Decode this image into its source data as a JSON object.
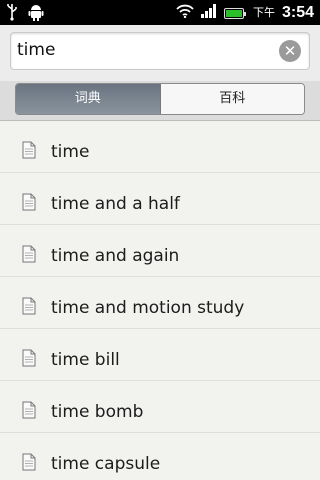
{
  "status_bar": {
    "ampm": "下午",
    "time": "3:54",
    "icons": [
      "usb-icon",
      "android-icon",
      "wifi-icon",
      "signal-icon",
      "battery-icon"
    ],
    "battery_color": "#2bc02b"
  },
  "search": {
    "value": "time"
  },
  "tabs": [
    {
      "label": "词典",
      "active": true
    },
    {
      "label": "百科",
      "active": false
    }
  ],
  "results": [
    {
      "label": "time"
    },
    {
      "label": "time and a half"
    },
    {
      "label": "time and again"
    },
    {
      "label": "time and motion study"
    },
    {
      "label": "time bill"
    },
    {
      "label": "time bomb"
    },
    {
      "label": "time capsule"
    }
  ]
}
